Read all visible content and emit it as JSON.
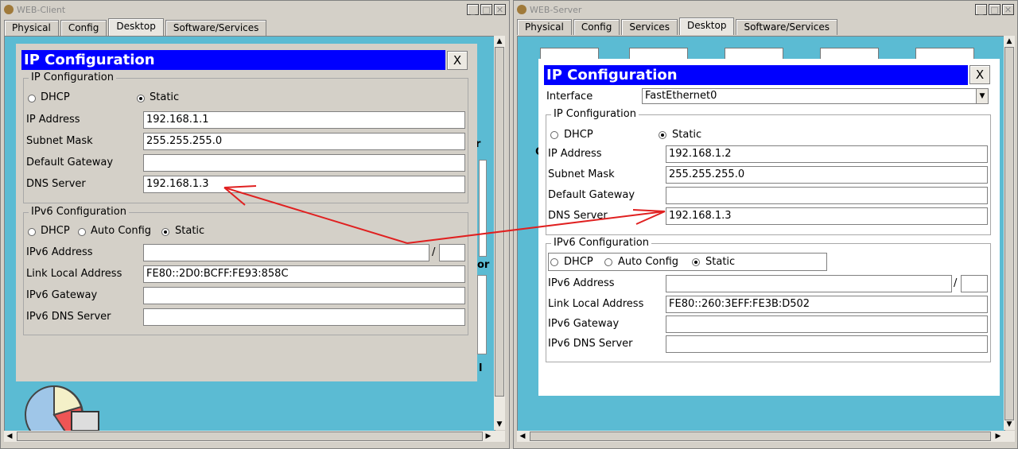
{
  "client_window": {
    "title": "WEB-Client",
    "tabs": [
      "Physical",
      "Config",
      "Desktop",
      "Software/Services"
    ],
    "active_tab": "Desktop",
    "dialog": {
      "title": "IP Configuration",
      "close_label": "X",
      "ipv4_group": "IP Configuration",
      "dhcp_label": "DHCP",
      "static_label": "Static",
      "mode": "Static",
      "ip_label": "IP Address",
      "ip_value": "192.168.1.1",
      "mask_label": "Subnet Mask",
      "mask_value": "255.255.255.0",
      "gw_label": "Default Gateway",
      "gw_value": "",
      "dns_label": "DNS Server",
      "dns_value": "192.168.1.3",
      "ipv6_group": "IPv6 Configuration",
      "dhcp6_label": "DHCP",
      "auto_label": "Auto Config",
      "static6_label": "Static",
      "mode6": "Static",
      "ipv6_label": "IPv6 Address",
      "ipv6_value": "",
      "prefix_sep": "/",
      "prefix_value": "",
      "lla_label": "Link Local Address",
      "lla_value": "FE80::2D0:BCFF:FE93:858C",
      "gw6_label": "IPv6 Gateway",
      "gw6_value": "",
      "dns6_label": "IPv6 DNS Server",
      "dns6_value": ""
    },
    "bg_fragments": [
      "r",
      "or",
      "l"
    ]
  },
  "server_window": {
    "title": "WEB-Server",
    "tabs": [
      "Physical",
      "Config",
      "Services",
      "Desktop",
      "Software/Services"
    ],
    "active_tab": "Desktop",
    "dialog": {
      "title": "IP Configuration",
      "close_label": "X",
      "interface_label": "Interface",
      "interface_value": "FastEthernet0",
      "ipv4_group": "IP Configuration",
      "dhcp_label": "DHCP",
      "static_label": "Static",
      "mode": "Static",
      "ip_label": "IP Address",
      "ip_value": "192.168.1.2",
      "mask_label": "Subnet Mask",
      "mask_value": "255.255.255.0",
      "gw_label": "Default Gateway",
      "gw_value": "",
      "dns_label": "DNS Server",
      "dns_value": "192.168.1.3",
      "ipv6_group": "IPv6 Configuration",
      "dhcp6_label": "DHCP",
      "auto_label": "Auto Config",
      "static6_label": "Static",
      "mode6": "Static",
      "ipv6_label": "IPv6 Address",
      "ipv6_value": "",
      "prefix_sep": "/",
      "prefix_value": "",
      "lla_label": "Link Local Address",
      "lla_value": "FE80::260:3EFF:FE3B:D502",
      "gw6_label": "IPv6 Gateway",
      "gw6_value": "",
      "dns6_label": "IPv6 DNS Server",
      "dns6_value": ""
    },
    "bg_fragments": [
      "C"
    ]
  },
  "window_buttons": {
    "minimize": "_",
    "maximize": "□",
    "close": "✕"
  },
  "icons": {
    "window_icon": "app-icon",
    "annotation_color": "#e02020",
    "title_bar_color": "#0000ff",
    "desktop_color": "#5bbbd3"
  }
}
